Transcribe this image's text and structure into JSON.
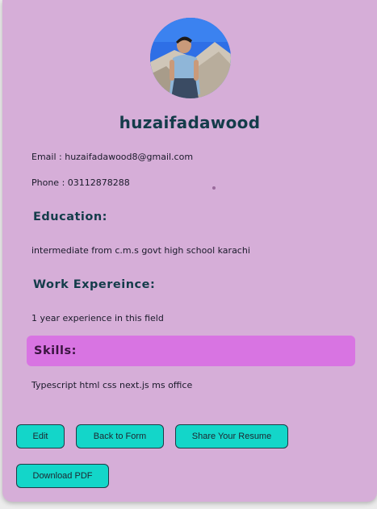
{
  "profile": {
    "name": "huzaifadawood",
    "email_line": "Email : huzaifadawood8@gmail.com",
    "phone_line": "Phone : 03112878288",
    "avatar_icon": "profile-photo"
  },
  "sections": {
    "education": {
      "heading": "Education:",
      "text": "intermediate from c.m.s govt high school karachi"
    },
    "work": {
      "heading": "Work Expereince:",
      "text": "1 year experience in this field"
    },
    "skills": {
      "heading": "Skills:",
      "text": "Typescript html css next.js ms office"
    }
  },
  "actions": {
    "edit": "Edit",
    "back": "Back to Form",
    "share": "Share Your Resume",
    "download": "Download PDF"
  },
  "colors": {
    "card_background": "#d6aed8",
    "skills_highlight": "#d874e2",
    "button_accent": "#13d6c9",
    "heading_text": "#143c4a"
  }
}
